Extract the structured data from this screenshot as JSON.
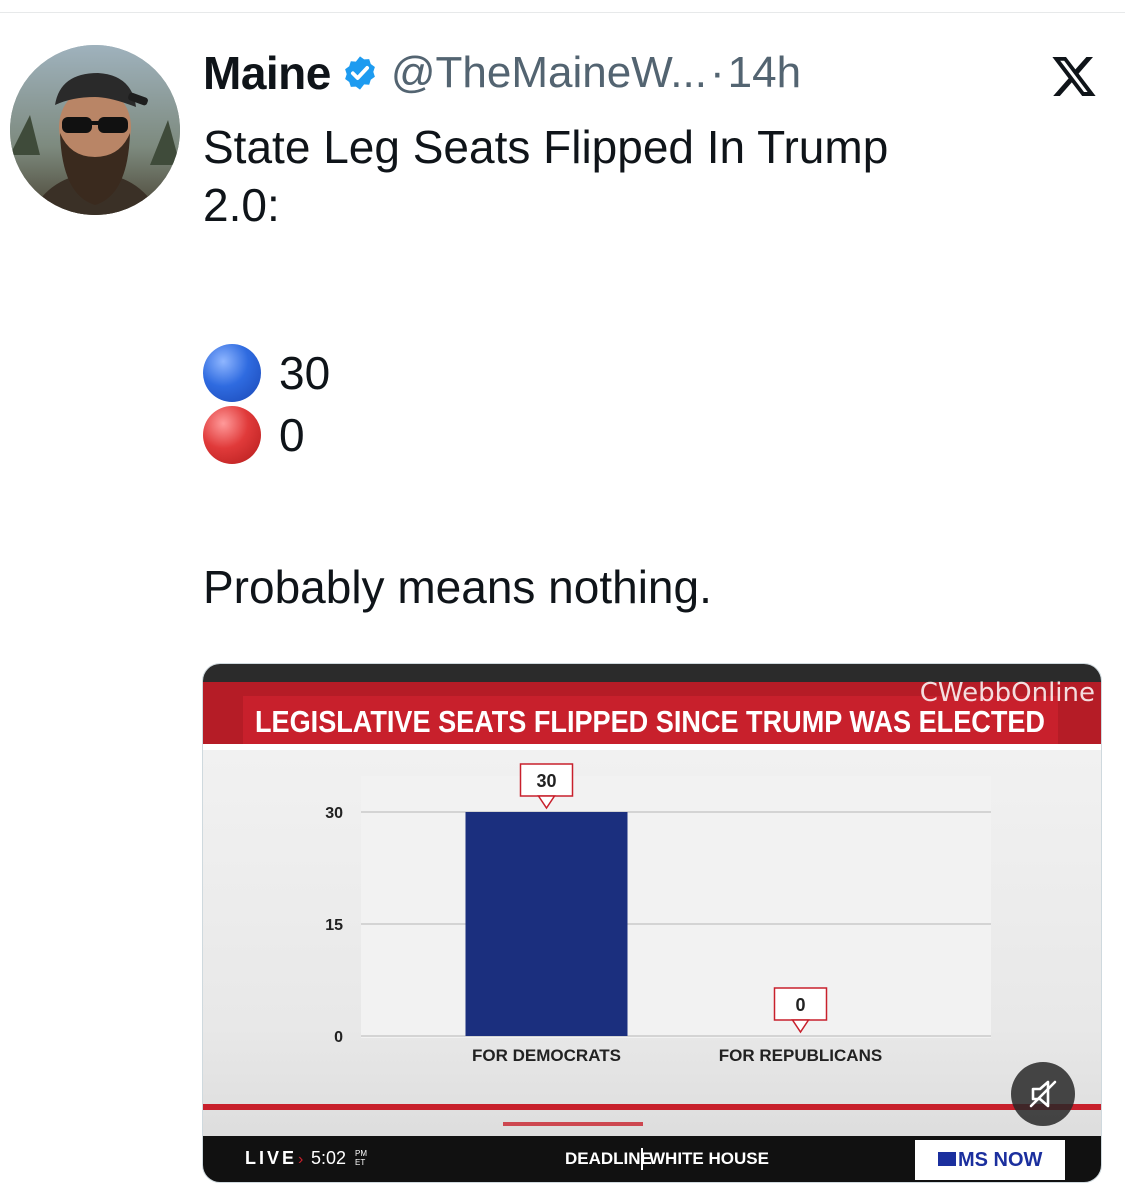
{
  "tweet": {
    "display_name": "Maine",
    "handle": "@TheMaineW...",
    "separator": "·",
    "time": "14h",
    "lines": [
      "State Leg Seats Flipped In Trump",
      "2.0:"
    ],
    "tally": [
      {
        "color": "blue",
        "value": "30"
      },
      {
        "color": "red",
        "value": "0"
      }
    ],
    "closing": "Probably means nothing."
  },
  "icons": {
    "avatar": "avatar",
    "verified": "verified-badge-icon",
    "platform": "x-logo-icon",
    "mute": "mute-icon"
  },
  "colors": {
    "verified_blue": "#1d9bf0",
    "dem_blue": "#1b2f7e",
    "banner_red": "#c8202c"
  },
  "media": {
    "banner_title": "LEGISLATIVE SEATS FLIPPED SINCE TRUMP WAS ELECTED",
    "watermark": "CWebbOnline",
    "live_label": "LIVE",
    "live_time": "5:02",
    "live_time_suffix_top": "PM",
    "live_time_suffix_bottom": "ET",
    "show_name_1": "DEADLINE",
    "show_name_2": "WHITE HOUSE",
    "network": "MS NOW"
  },
  "chart_data": {
    "type": "bar",
    "categories": [
      "FOR DEMOCRATS",
      "FOR REPUBLICANS"
    ],
    "values": [
      30,
      0
    ],
    "data_labels": [
      "30",
      "0"
    ],
    "title": "LEGISLATIVE SEATS FLIPPED SINCE TRUMP WAS ELECTED",
    "yticks": [
      0,
      15,
      30
    ],
    "ylim": [
      0,
      30
    ],
    "grid": true,
    "bar_colors": [
      "#1b2f7e",
      "#1b2f7e"
    ]
  }
}
